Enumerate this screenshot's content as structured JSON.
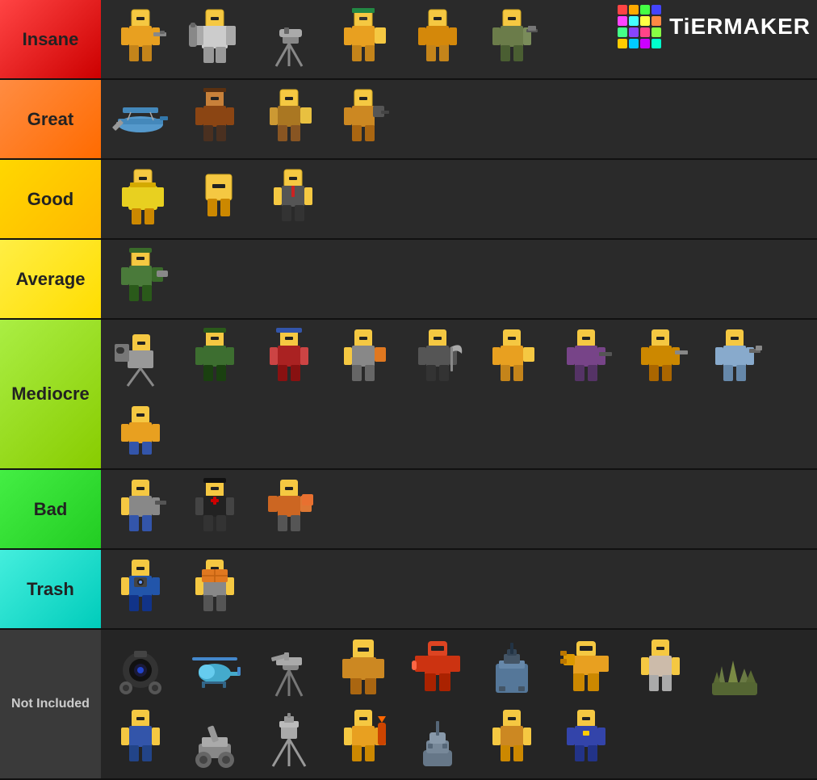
{
  "logo": {
    "text": "TiERMAKER",
    "grid_colors": [
      "#ff4444",
      "#ffaa00",
      "#44ff44",
      "#4444ff",
      "#ff44ff",
      "#44ffff",
      "#ffff44",
      "#ff8844",
      "#44ff88",
      "#8844ff",
      "#ff4488",
      "#88ff44",
      "#ffcc00",
      "#00ccff",
      "#cc00ff",
      "#00ffcc"
    ]
  },
  "tiers": [
    {
      "id": "insane",
      "label": "Insane",
      "color": "#ff4d4d",
      "items_count": 6,
      "items": [
        "insane1",
        "insane2",
        "insane3",
        "insane4",
        "insane5",
        "insane6"
      ]
    },
    {
      "id": "great",
      "label": "Great",
      "color": "#ff8c42",
      "items_count": 4,
      "items": [
        "great1",
        "great2",
        "great3",
        "great4"
      ]
    },
    {
      "id": "good",
      "label": "Good",
      "color": "#ffd700",
      "items_count": 3,
      "items": [
        "good1",
        "good2",
        "good3"
      ]
    },
    {
      "id": "average",
      "label": "Average",
      "color": "#ffee44",
      "items_count": 1,
      "items": [
        "avg1"
      ]
    },
    {
      "id": "mediocre",
      "label": "Mediocre",
      "color": "#aaee44",
      "items_count": 10,
      "items": [
        "med1",
        "med2",
        "med3",
        "med4",
        "med5",
        "med6",
        "med7",
        "med8",
        "med9",
        "med10"
      ]
    },
    {
      "id": "bad",
      "label": "Bad",
      "color": "#44ee44",
      "items_count": 3,
      "items": [
        "bad1",
        "bad2",
        "bad3"
      ]
    },
    {
      "id": "trash",
      "label": "Trash",
      "color": "#44eedd",
      "items_count": 2,
      "items": [
        "trash1",
        "trash2"
      ]
    },
    {
      "id": "notincluded",
      "label": "Not Included",
      "color": "#3a3a3a",
      "items_count": 18,
      "items": [
        "ni1",
        "ni2",
        "ni3",
        "ni4",
        "ni5",
        "ni6",
        "ni7",
        "ni8",
        "ni9",
        "ni10",
        "ni11",
        "ni12",
        "ni13",
        "ni14",
        "ni15",
        "ni16",
        "ni17",
        "ni18"
      ]
    }
  ]
}
